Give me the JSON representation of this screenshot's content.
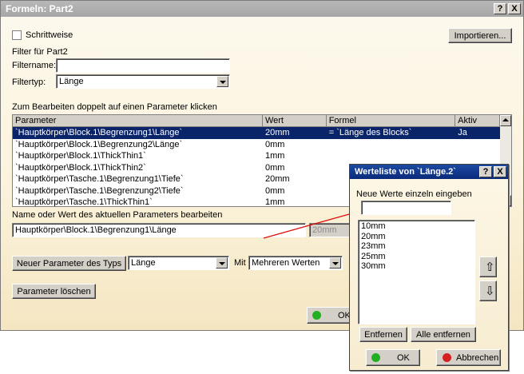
{
  "main": {
    "title": "Formeln: Part2",
    "help_label": "?",
    "close_label": "X",
    "stepwise_label": "Schrittweise",
    "import_label": "Importieren...",
    "filter_header": "Filter für Part2",
    "filter_name_label": "Filtername:",
    "filter_name_value": "",
    "filter_type_label": "Filtertyp:",
    "filter_type_value": "Länge",
    "instruction": "Zum Bearbeiten doppelt auf einen Parameter klicken",
    "table": {
      "headers": [
        "Parameter",
        "Wert",
        "Formel",
        "Aktiv"
      ],
      "rows": [
        [
          "`Hauptkörper\\Block.1\\Begrenzung1\\Länge`",
          "20mm",
          "= `Länge des Blocks`",
          "Ja"
        ],
        [
          "`Hauptkörper\\Block.1\\Begrenzung2\\Länge`",
          "0mm",
          "",
          ""
        ],
        [
          "`Hauptkörper\\Block.1\\ThickThin1`",
          "1mm",
          "",
          ""
        ],
        [
          "`Hauptkörper\\Block.1\\ThickThin2`",
          "0mm",
          "",
          ""
        ],
        [
          "`Hauptkörper\\Tasche.1\\Begrenzung1\\Tiefe`",
          "20mm",
          "",
          ""
        ],
        [
          "`Hauptkörper\\Tasche.1\\Begrenzung2\\Tiefe`",
          "0mm",
          "",
          ""
        ],
        [
          "`Hauptkörper\\Tasche.1\\ThickThin1`",
          "1mm",
          "",
          ""
        ]
      ],
      "selected_row": 0
    },
    "edit_label": "Name oder Wert des aktuellen Parameters bearbeiten",
    "edit_name_value": "Hauptkörper\\Block.1\\Begrenzung1\\Länge",
    "edit_value": "20mm",
    "new_param_label": "Neuer Parameter des Typs",
    "new_param_type": "Länge",
    "with_label": "Mit",
    "with_value": "Mehreren Werten",
    "delete_param_label": "Parameter löschen",
    "ok_label": "OK"
  },
  "popup": {
    "title": "Werteliste von `Länge.2`",
    "help_label": "?",
    "close_label": "X",
    "input_label": "Neue Werte einzeln eingeben",
    "input_value": "",
    "values": [
      "10mm",
      "20mm",
      "23mm",
      "25mm",
      "30mm"
    ],
    "move_up_glyph": "⇧",
    "move_down_glyph": "⇩",
    "remove_label": "Entfernen",
    "remove_all_label": "Alle entfernen",
    "ok_label": "OK",
    "cancel_label": "Abbrechen"
  },
  "colors": {
    "selection": "#0a246a",
    "ok_dot": "#21b021",
    "cancel_dot": "#d42020",
    "arrow": "#e01010"
  }
}
